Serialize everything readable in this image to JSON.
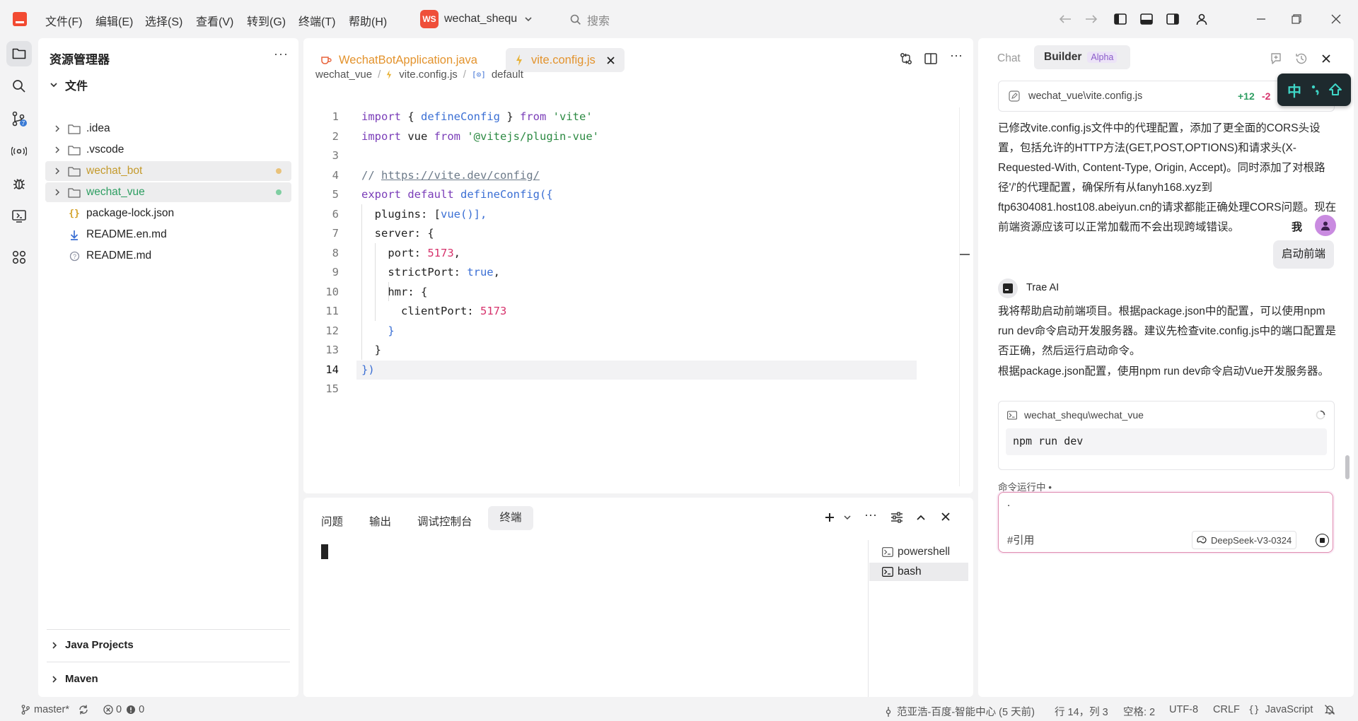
{
  "app": {
    "project_badge": "WS",
    "project_name": "wechat_shequ",
    "search_placeholder": "搜索"
  },
  "menu": [
    "文件(F)",
    "编辑(E)",
    "选择(S)",
    "查看(V)",
    "转到(G)",
    "终端(T)",
    "帮助(H)"
  ],
  "explorer": {
    "title": "资源管理器",
    "more": "···",
    "section_title": "文件",
    "items": [
      {
        "name": ".idea",
        "type": "folder"
      },
      {
        "name": ".vscode",
        "type": "folder"
      },
      {
        "name": "wechat_bot",
        "type": "folder",
        "status": "modified"
      },
      {
        "name": "wechat_vue",
        "type": "folder",
        "status": "added"
      },
      {
        "name": "package-lock.json",
        "type": "json"
      },
      {
        "name": "README.en.md",
        "type": "md-download"
      },
      {
        "name": "README.md",
        "type": "md-info"
      }
    ],
    "bottom_sections": [
      "Java Projects",
      "Maven"
    ]
  },
  "editor": {
    "tabs": [
      {
        "label": "WechatBotApplication.java",
        "active": false
      },
      {
        "label": "vite.config.js",
        "active": true
      }
    ],
    "breadcrumb": [
      "wechat_vue",
      "vite.config.js",
      "default"
    ],
    "current_line": 14,
    "line_numbers": [
      "1",
      "2",
      "3",
      "4",
      "5",
      "6",
      "7",
      "8",
      "9",
      "10",
      "11",
      "12",
      "13",
      "14",
      "15"
    ],
    "code": {
      "l1": {
        "kw1": "import",
        "p1": " { ",
        "fn": "defineConfig",
        "p2": " } ",
        "kw2": "from",
        "sp": " ",
        "str": "'vite'"
      },
      "l2": {
        "kw1": "import",
        "v": " vue ",
        "kw2": "from",
        "sp": " ",
        "str": "'@vitejs/plugin-vue'"
      },
      "l4": {
        "comment": "// ",
        "url": "https://vite.dev/config/"
      },
      "l5": {
        "kw1": "export",
        "sp": " ",
        "kw2": "default",
        "sp2": " ",
        "fn": "defineConfig",
        "p": "({"
      },
      "l6": {
        "prop": "  plugins: [",
        "fn": "vue",
        "p": "()],"
      },
      "l7": {
        "prop": "  server: {"
      },
      "l8": {
        "prop": "    port: ",
        "num": "5173",
        "p": ","
      },
      "l9": {
        "prop": "    strictPort: ",
        "bool": "true",
        "p": ","
      },
      "l10": {
        "prop": "    hmr: {"
      },
      "l11": {
        "prop": "      clientPort: ",
        "num": "5173"
      },
      "l12": {
        "prop": "    }"
      },
      "l13": {
        "prop": "  }"
      },
      "l14": {
        "prop": "})"
      }
    }
  },
  "terminal": {
    "tabs": [
      "问题",
      "输出",
      "调试控制台",
      "终端"
    ],
    "active_tab": "终端",
    "shells": [
      "powershell",
      "bash"
    ],
    "active_shell": "bash"
  },
  "chat": {
    "tabs": [
      "Chat",
      "Builder"
    ],
    "builder_badge": "Alpha",
    "ime_label": "中",
    "file_card": {
      "path": "wechat_vue\\vite.config.js",
      "added": "+12",
      "removed": "-2"
    },
    "ai_message_1": "已修改vite.config.js文件中的代理配置，添加了更全面的CORS头设置，包括允许的HTTP方法(GET,POST,OPTIONS)和请求头(X-Requested-With, Content-Type, Origin, Accept)。同时添加了对根路径'/'的代理配置，确保所有从fanyh168.xyz到ftp6304081.host108.abeiyun.cn的请求都能正确处理CORS问题。现在前端资源应该可以正常加载而不会出现跨域错误。",
    "user_name": "我",
    "user_message": "启动前端",
    "ai_name": "Trae AI",
    "ai_message_2": "我将帮助启动前端项目。根据package.json中的配置，可以使用npm run dev命令启动开发服务器。建议先检查vite.config.js中的端口配置是否正确，然后运行启动命令。",
    "ai_message_3": "根据package.json配置，使用npm run dev命令启动Vue开发服务器。",
    "command_card": {
      "cwd": "wechat_shequ\\wechat_vue",
      "command": "npm run dev"
    },
    "command_status": "命令运行中 •",
    "input": {
      "value": ".",
      "ref_label": "#引用",
      "model": "DeepSeek-V3-0324"
    }
  },
  "statusbar": {
    "branch": "master*",
    "errors": "0",
    "warnings": "0",
    "author": "范亚浩-百度-智能中心 (5 天前)",
    "position": "行 14，列 3",
    "spaces": "空格: 2",
    "encoding": "UTF-8",
    "eol": "CRLF",
    "language": "JavaScript"
  },
  "colors": {
    "accent_orange": "#e8a23a",
    "modified": "#c49a2c",
    "added": "#2e9e62",
    "keyword": "#7a3db8",
    "string": "#2d8a43",
    "function": "#3b6fd4",
    "number": "#d6336c"
  }
}
